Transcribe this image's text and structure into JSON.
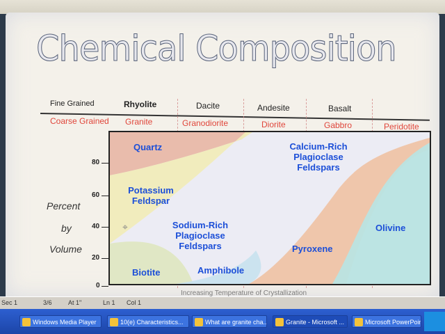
{
  "slide": {
    "title": "Chemical Composition",
    "row_fine_label": "Fine Grained",
    "row_coarse_label": "Coarse Grained",
    "fine_rocks": [
      "Rhyolite",
      "Dacite",
      "Andesite",
      "Basalt"
    ],
    "coarse_rocks": [
      "Granite",
      "Granodiorite",
      "Diorite",
      "Gabbro",
      "Peridotite"
    ],
    "y_axis_words": [
      "Percent",
      "by",
      "Volume"
    ],
    "x_caption": "Increasing Temperature of Crystallization",
    "colors": {
      "title": "#59637a",
      "region_label": "#1c4fd8",
      "coarse_label": "#e0463b"
    }
  },
  "chart_data": {
    "type": "area",
    "ylim": [
      0,
      100
    ],
    "y_ticks": [
      "0",
      "20",
      "40",
      "60",
      "80"
    ],
    "region_labels": [
      "Quartz",
      "Potassium Feldspar",
      "Sodium-Rich Plagioclase Feldspars",
      "Biotite",
      "Amphibole",
      "Calcium-Rich Plagioclase Feldspars",
      "Pyroxene",
      "Olivine"
    ],
    "region_colors": {
      "Quartz": "#e9b9a8",
      "Potassium Feldspar": "#f1ecb9",
      "Sodium-Rich Plagioclase Feldspars": "#e4e3f2",
      "Biotite": "#dfe7c2",
      "Amphibole": "#c9e3ee",
      "Calcium-Rich Plagioclase Feldspars": "#e4e3f2",
      "Pyroxene": "#efc4a6",
      "Olivine": "#b9e4e2"
    }
  },
  "statusbar": {
    "items": [
      "Sec 1",
      "3/6",
      "At 1\"",
      "Ln 1",
      "Col 1"
    ]
  },
  "taskbar": {
    "tasks": [
      "Windows Media Player",
      "10(e) Characteristics...",
      "What are granite cha...",
      "Granite - Microsoft ...",
      "Microsoft PowerPoint..."
    ]
  }
}
